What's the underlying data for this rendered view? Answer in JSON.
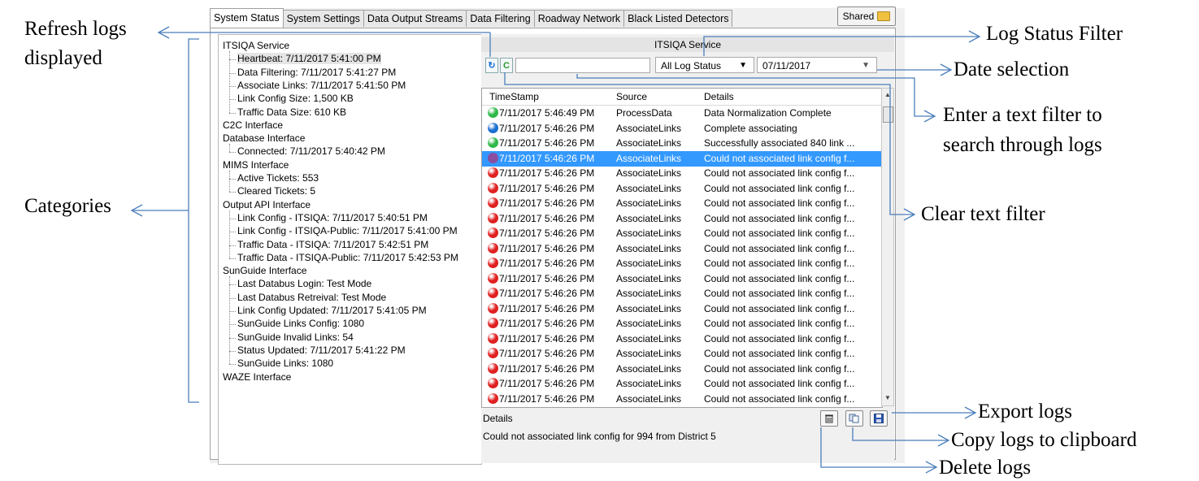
{
  "tabs": [
    "System Status",
    "System Settings",
    "Data Output Streams",
    "Data Filtering",
    "Roadway Network",
    "Black Listed Detectors"
  ],
  "shared_label": "Shared",
  "tree": [
    {
      "label": "ITSIQA Service",
      "children": [
        "Heartbeat: 7/11/2017 5:41:00 PM",
        "Data Filtering: 7/11/2017 5:41:27 PM",
        "Associate Links: 7/11/2017 5:41:50 PM",
        "Link Config Size: 1,500 KB",
        "Traffic Data Size: 610 KB"
      ]
    },
    {
      "label": "C2C Interface",
      "children": []
    },
    {
      "label": "Database Interface",
      "children": [
        "Connected: 7/11/2017 5:40:42 PM"
      ]
    },
    {
      "label": "MIMS Interface",
      "children": [
        "Active Tickets: 553",
        "Cleared Tickets: 5"
      ]
    },
    {
      "label": "Output API Interface",
      "children": [
        "Link Config - ITSIQA: 7/11/2017 5:40:51 PM",
        "Link Config - ITSIQA-Public: 7/11/2017 5:41:00 PM",
        "Traffic Data - ITSIQA: 7/11/2017 5:42:51 PM",
        "Traffic Data - ITSIQA-Public: 7/11/2017 5:42:53 PM"
      ]
    },
    {
      "label": "SunGuide Interface",
      "children": [
        "Last Databus Login: Test Mode",
        "Last Databus Retreival: Test Mode",
        "Link Config Updated: 7/11/2017 5:41:05 PM",
        "SunGuide Links Config: 1080",
        "SunGuide Invalid Links: 54",
        "Status Updated: 7/11/2017 5:41:22 PM",
        "SunGuide Links: 1080"
      ]
    },
    {
      "label": "WAZE Interface",
      "children": []
    }
  ],
  "service_title": "ITSIQA Service",
  "filter": {
    "refresh_glyph": "↻",
    "clear_glyph": "C",
    "text_value": "",
    "status_value": "All Log Status",
    "date_value": "07/11/2017"
  },
  "grid": {
    "headers": [
      "TimeStamp",
      "Source",
      "Details"
    ],
    "rows": [
      {
        "status": "green",
        "ts": "7/11/2017 5:46:49 PM",
        "source": "ProcessData",
        "details": "Data Normalization Complete"
      },
      {
        "status": "blue",
        "ts": "7/11/2017 5:46:26 PM",
        "source": "AssociateLinks",
        "details": "Complete associating"
      },
      {
        "status": "green",
        "ts": "7/11/2017 5:46:26 PM",
        "source": "AssociateLinks",
        "details": "Successfully associated 840 link ..."
      },
      {
        "status": "red",
        "ts": "7/11/2017 5:46:26 PM",
        "source": "AssociateLinks",
        "details": "Could not associated link config f...",
        "selected": true
      },
      {
        "status": "red",
        "ts": "7/11/2017 5:46:26 PM",
        "source": "AssociateLinks",
        "details": "Could not associated link config f..."
      },
      {
        "status": "red",
        "ts": "7/11/2017 5:46:26 PM",
        "source": "AssociateLinks",
        "details": "Could not associated link config f..."
      },
      {
        "status": "red",
        "ts": "7/11/2017 5:46:26 PM",
        "source": "AssociateLinks",
        "details": "Could not associated link config f..."
      },
      {
        "status": "red",
        "ts": "7/11/2017 5:46:26 PM",
        "source": "AssociateLinks",
        "details": "Could not associated link config f..."
      },
      {
        "status": "red",
        "ts": "7/11/2017 5:46:26 PM",
        "source": "AssociateLinks",
        "details": "Could not associated link config f..."
      },
      {
        "status": "red",
        "ts": "7/11/2017 5:46:26 PM",
        "source": "AssociateLinks",
        "details": "Could not associated link config f..."
      },
      {
        "status": "red",
        "ts": "7/11/2017 5:46:26 PM",
        "source": "AssociateLinks",
        "details": "Could not associated link config f..."
      },
      {
        "status": "red",
        "ts": "7/11/2017 5:46:26 PM",
        "source": "AssociateLinks",
        "details": "Could not associated link config f..."
      },
      {
        "status": "red",
        "ts": "7/11/2017 5:46:26 PM",
        "source": "AssociateLinks",
        "details": "Could not associated link config f..."
      },
      {
        "status": "red",
        "ts": "7/11/2017 5:46:26 PM",
        "source": "AssociateLinks",
        "details": "Could not associated link config f..."
      },
      {
        "status": "red",
        "ts": "7/11/2017 5:46:26 PM",
        "source": "AssociateLinks",
        "details": "Could not associated link config f..."
      },
      {
        "status": "red",
        "ts": "7/11/2017 5:46:26 PM",
        "source": "AssociateLinks",
        "details": "Could not associated link config f..."
      },
      {
        "status": "red",
        "ts": "7/11/2017 5:46:26 PM",
        "source": "AssociateLinks",
        "details": "Could not associated link config f..."
      },
      {
        "status": "red",
        "ts": "7/11/2017 5:46:26 PM",
        "source": "AssociateLinks",
        "details": "Could not associated link config f..."
      },
      {
        "status": "red",
        "ts": "7/11/2017 5:46:26 PM",
        "source": "AssociateLinks",
        "details": "Could not associated link config f..."
      },
      {
        "status": "red",
        "ts": "7/11/2017 5:46:26 PM",
        "source": "AssociateLinks",
        "details": "Could not associated link config f..."
      }
    ]
  },
  "details_label": "Details",
  "details_text": "Could not associated link config for 994 from District 5",
  "annotations": {
    "refresh_1": "Refresh logs",
    "refresh_2": "displayed",
    "categories": "Categories",
    "log_status": "Log Status Filter",
    "date_sel": "Date selection",
    "text_filter_1": "Enter a text filter to",
    "text_filter_2": "search through logs",
    "clear_filter": "Clear text filter",
    "export": "Export logs",
    "copy": "Copy logs to clipboard",
    "delete": "Delete logs"
  },
  "colors": {
    "accent": "#4a7ebb",
    "selection": "#3399ff",
    "green": "#2fb84a",
    "red": "#e02020",
    "blue": "#1a6fd0"
  },
  "icons": [
    "refresh-icon",
    "clear-icon",
    "folder-icon",
    "trash-icon",
    "copy-icon",
    "save-icon",
    "scroll-up-icon",
    "scroll-down-icon"
  ]
}
